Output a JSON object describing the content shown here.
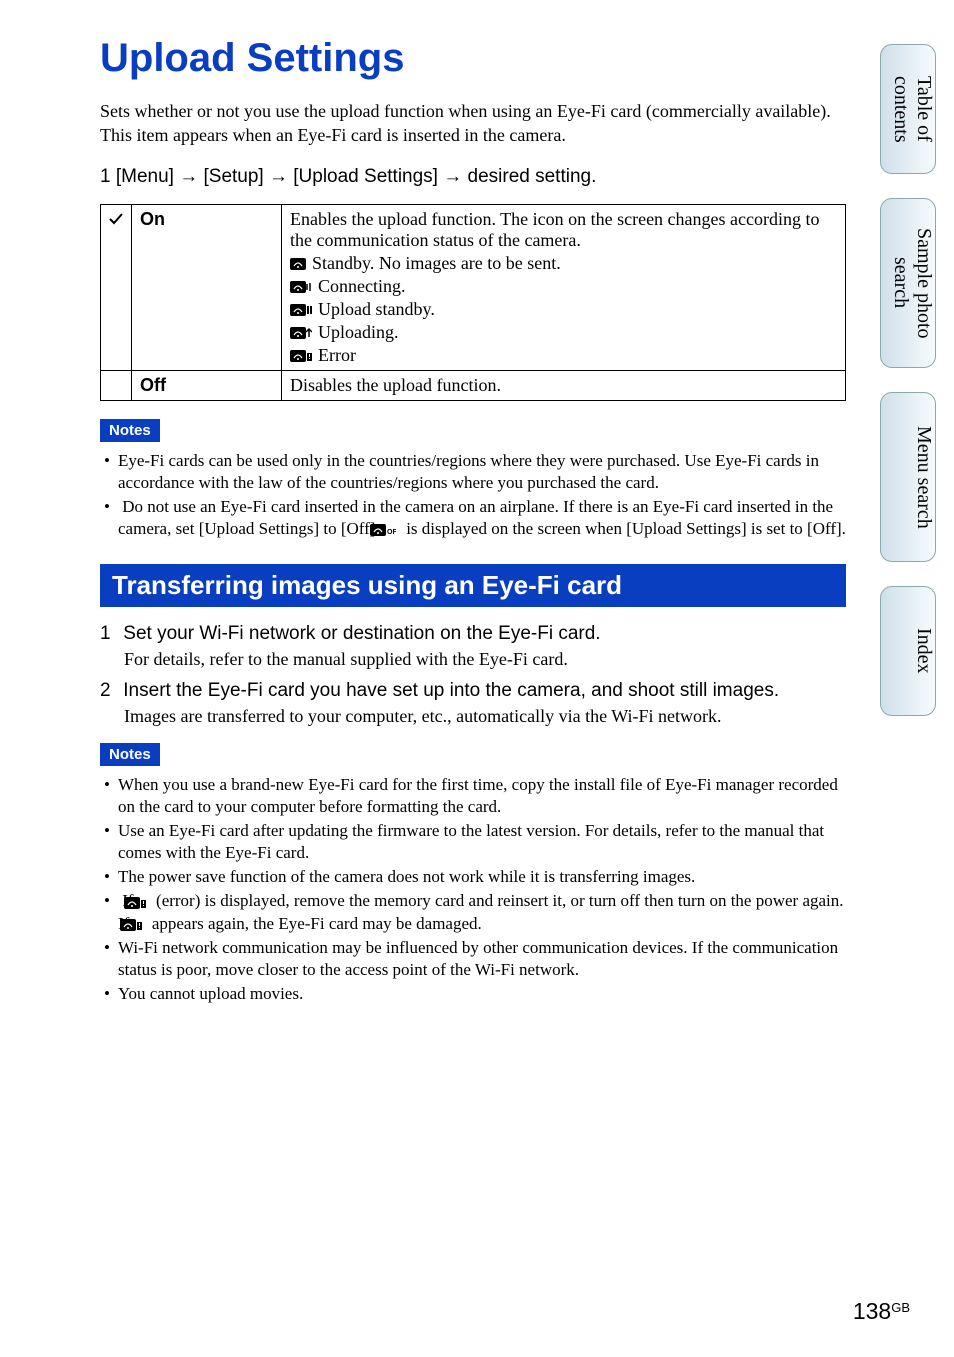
{
  "title": "Upload Settings",
  "intro": "Sets whether or not you use the upload function when using an Eye-Fi card (commercially available). This item appears when an Eye-Fi card is inserted in the camera.",
  "first_step": "1  [Menu] → [Setup] → [Upload Settings] → desired setting.",
  "options": {
    "on": {
      "name": "On",
      "desc_lead": "Enables the upload function. The icon on the screen changes according to the communication status of the camera.",
      "statuses": [
        "Standby. No images are to be sent.",
        "Connecting.",
        "Upload standby.",
        "Uploading.",
        "Error"
      ]
    },
    "off": {
      "name": "Off",
      "desc": "Disables the upload function."
    }
  },
  "notes1_label": "Notes",
  "notes1": [
    "Eye-Fi cards can be used only in the countries/regions where they were purchased. Use Eye-Fi cards in accordance with the law of the countries/regions where you purchased the card."
  ],
  "notes1_special": {
    "pre": "Do not use an Eye-Fi card inserted in the camera on an airplane. If there is an Eye-Fi card inserted in the camera, set [Upload Settings] to [Off]. ",
    "post": " is displayed on the screen when [Upload Settings] is set to [Off]."
  },
  "banner": "Transferring images using an Eye-Fi card",
  "steps": [
    {
      "num": "1",
      "head": "Set your Wi-Fi network or destination on the Eye-Fi card.",
      "body": "For details, refer to the manual supplied with the Eye-Fi card."
    },
    {
      "num": "2",
      "head": "Insert the Eye-Fi card you have set up into the camera, and shoot still images.",
      "body": "Images are transferred to your computer, etc., automatically via the Wi-Fi network."
    }
  ],
  "notes2_label": "Notes",
  "notes2": [
    "When you use a brand-new Eye-Fi card for the first time, copy the install file of Eye-Fi manager recorded on the card to your computer before formatting the card.",
    "Use an Eye-Fi card after updating the firmware to the latest version. For details, refer to the manual that comes with the Eye-Fi card.",
    "The power save function of the camera does not work while it is transferring images."
  ],
  "notes2_special": {
    "pre": "If ",
    "mid": " (error) is displayed, remove the memory card and reinsert it, or turn off then turn on the power again. If ",
    "post": " appears again, the Eye-Fi card may be damaged."
  },
  "notes2_tail": [
    "Wi-Fi network communication may be influenced by other communication devices. If the communication status is poor, move closer to the access point of the Wi-Fi network.",
    "You cannot upload movies."
  ],
  "tabs": {
    "toc": "Table of contents",
    "sample": "Sample photo search",
    "menu": "Menu search",
    "index": "Index"
  },
  "page_number": "138",
  "page_suffix": "GB"
}
